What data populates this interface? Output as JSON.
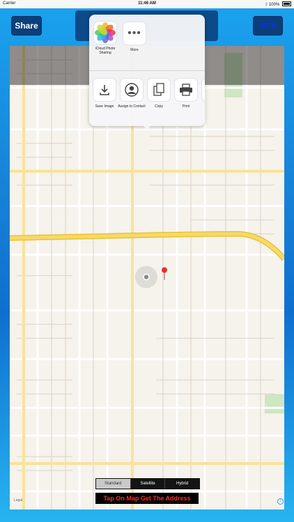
{
  "status_bar": {
    "carrier": "Carrier",
    "time": "11:46 AM",
    "battery": "100%"
  },
  "toolbar": {
    "share_label": "Share",
    "gps_label": "GPS"
  },
  "share_sheet": {
    "apps": [
      {
        "label": "iCloud Photo Sharing",
        "icon": "photos-icon"
      },
      {
        "label": "More",
        "icon": "more-icon"
      }
    ],
    "actions": [
      {
        "label": "Save Image",
        "icon": "save-image-icon"
      },
      {
        "label": "Assign to Contact",
        "icon": "contact-icon"
      },
      {
        "label": "Copy",
        "icon": "copy-icon"
      },
      {
        "label": "Print",
        "icon": "print-icon"
      },
      {
        "label": "A",
        "icon": "partial-icon"
      }
    ]
  },
  "map_type": {
    "options": [
      "Standard",
      "Satellite",
      "Hybrid"
    ],
    "selected": "Standard"
  },
  "hint": {
    "tap_label": "Tap On Map Get The Address"
  },
  "legal": {
    "text": "Legal"
  },
  "colors": {
    "accent": "#1783d8",
    "hint_text": "#ff2a2a",
    "highway": "#f4d44a"
  }
}
